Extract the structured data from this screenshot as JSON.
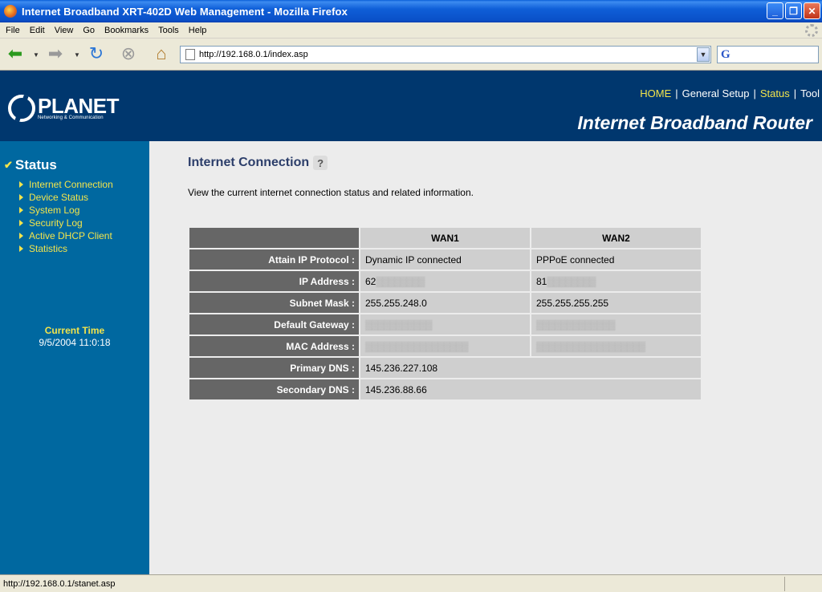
{
  "window": {
    "title": "Internet Broadband XRT-402D Web Management - Mozilla Firefox",
    "minimize": "_",
    "restore": "❐",
    "close": "✕"
  },
  "menu": [
    "File",
    "Edit",
    "View",
    "Go",
    "Bookmarks",
    "Tools",
    "Help"
  ],
  "toolbar": {
    "url": "http://192.168.0.1/index.asp"
  },
  "header": {
    "logo_main": "PLANET",
    "logo_sub": "Networking & Communication",
    "nav": [
      "HOME",
      "General Setup",
      "Status",
      "Tool"
    ],
    "product": "Internet Broadband Router"
  },
  "sidebar": {
    "heading": "Status",
    "items": [
      "Internet Connection",
      "Device Status",
      "System Log",
      "Security Log",
      "Active DHCP Client",
      "Statistics"
    ],
    "time_label": "Current Time",
    "time_value": "9/5/2004 11:0:18"
  },
  "main": {
    "title": "Internet Connection",
    "description": "View the current internet connection status and related information.",
    "columns": [
      "WAN1",
      "WAN2"
    ],
    "rows": [
      {
        "label": "Attain IP Protocol :",
        "wan1": "Dynamic IP connected",
        "wan2": "PPPoE connected"
      },
      {
        "label": "IP Address :",
        "wan1": "62",
        "wan2": "81"
      },
      {
        "label": "Subnet Mask :",
        "wan1": "255.255.248.0",
        "wan2": "255.255.255.255"
      },
      {
        "label": "Default Gateway :",
        "wan1": "",
        "wan2": ""
      },
      {
        "label": "MAC Address :",
        "wan1": "",
        "wan2": ""
      },
      {
        "label": "Primary DNS :",
        "value": "145.236.227.108"
      },
      {
        "label": "Secondary DNS :",
        "value": "145.236.88.66"
      }
    ]
  },
  "statusbar": {
    "text": "http://192.168.0.1/stanet.asp"
  },
  "colors": {
    "header_bg": "#00376E",
    "sidebar_bg": "#0068A0",
    "accent_yellow": "#F2E44C",
    "label_cell": "#666666",
    "value_cell": "#CFCFCF"
  }
}
